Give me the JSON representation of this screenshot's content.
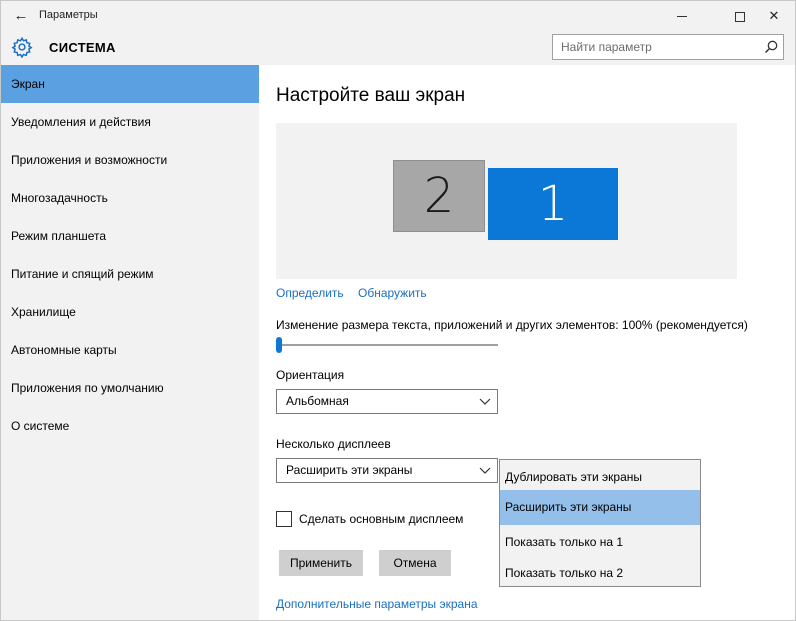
{
  "window": {
    "title": "Параметры",
    "back_glyph": "←",
    "close_glyph": "✕"
  },
  "header": {
    "title": "СИСТЕМА",
    "search_placeholder": "Найти параметр",
    "icon": "gear-icon"
  },
  "sidebar": {
    "items": [
      {
        "label": "Экран",
        "active": true
      },
      {
        "label": "Уведомления и действия"
      },
      {
        "label": "Приложения и возможности"
      },
      {
        "label": "Многозадачность"
      },
      {
        "label": "Режим планшета"
      },
      {
        "label": "Питание и спящий режим"
      },
      {
        "label": "Хранилище"
      },
      {
        "label": "Автономные карты"
      },
      {
        "label": "Приложения по умолчанию"
      },
      {
        "label": "О системе"
      }
    ]
  },
  "main": {
    "title": "Настройте ваш экран",
    "monitors": [
      {
        "number": "2",
        "color": "#a7a7a7"
      },
      {
        "number": "1",
        "color": "#0b78d7"
      }
    ],
    "links": {
      "identify": "Определить",
      "detect": "Обнаружить",
      "advanced": "Дополнительные параметры экрана"
    },
    "scale": {
      "label": "Изменение размера текста, приложений и других элементов: 100% (рекомендуется)",
      "value_fraction": 0.0
    },
    "orientation": {
      "label": "Ориентация",
      "value": "Альбомная"
    },
    "multiple_displays": {
      "label": "Несколько дисплеев",
      "value": "Расширить эти экраны",
      "options": [
        "Дублировать эти экраны",
        "Расширить эти экраны",
        "Показать только на 1",
        "Показать только на 2"
      ],
      "selected_index": 1
    },
    "make_main": {
      "label": "Сделать основным дисплеем",
      "checked": false
    },
    "buttons": {
      "apply": "Применить",
      "cancel": "Отмена"
    }
  },
  "colors": {
    "accent": "#0b78d7",
    "nav_active": "#5ba1e1",
    "dropdown_selected": "#93bfea",
    "link": "#1b6ec2"
  }
}
